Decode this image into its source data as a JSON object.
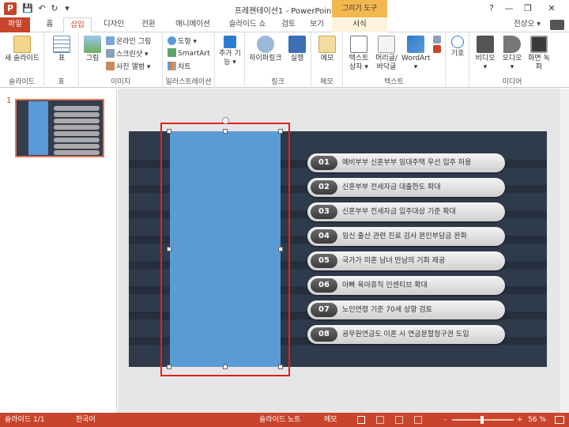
{
  "window": {
    "title": "프레젠테이션1 - PowerPoint",
    "app_icon_letter": "P",
    "context_tool": "그리기 도구",
    "help_glyph": "?",
    "minimize_glyph": "—",
    "restore_glyph": "❐",
    "close_glyph": "✕"
  },
  "quick_access": {
    "save_glyph": "💾",
    "undo_glyph": "↶",
    "redo_glyph": "↻",
    "customize_glyph": "▾"
  },
  "tabs": {
    "file": "파일",
    "home": "홈",
    "insert": "삽입",
    "design": "디자인",
    "transitions": "전환",
    "animations": "애니메이션",
    "slideshow": "슬라이드 쇼",
    "review": "검토",
    "view": "보기",
    "format": "서식"
  },
  "user": {
    "name": "전상오 ▾"
  },
  "ribbon": {
    "slides": {
      "label": "슬라이드",
      "new_slide": "새 슬라이드"
    },
    "tables": {
      "label": "표",
      "table": "표"
    },
    "images": {
      "label": "이미지",
      "picture": "그림",
      "online_picture": "온라인 그림",
      "screenshot": "스크린샷 ▾",
      "photo_album": "사진 앨범 ▾"
    },
    "illustrations": {
      "label": "일러스트레이션",
      "shapes": "도형 ▾",
      "smartart": "SmartArt",
      "chart": "차트"
    },
    "addins": {
      "label": "",
      "addins": "추가 기능 ▾"
    },
    "links": {
      "label": "링크",
      "hyperlink": "하이퍼링크",
      "action": "실행"
    },
    "comments": {
      "label": "메모",
      "comment": "메모"
    },
    "text": {
      "label": "텍스트",
      "textbox": "텍스트 상자 ▾",
      "header_footer": "머리글/ 바닥글",
      "wordart": "WordArt ▾"
    },
    "symbols": {
      "label": "",
      "symbol": "기호"
    },
    "media": {
      "label": "미디어",
      "video": "비디오 ▾",
      "audio": "오디오 ▾",
      "screen_recording": "화면 녹화"
    }
  },
  "thumbnail": {
    "number": "1"
  },
  "slide": {
    "items": [
      {
        "num": "01",
        "text": "예비부부 신혼부부 임대주택 우선 입주 허용"
      },
      {
        "num": "02",
        "text": "신혼부부 전세자금 대출한도 확대"
      },
      {
        "num": "03",
        "text": "신혼부부 전세자금 입주대상 기준 확대"
      },
      {
        "num": "04",
        "text": "임신 출산 관련 진료 검사 본인부담금 완화"
      },
      {
        "num": "05",
        "text": "국가가 미혼 남녀 만남의 기회 제공"
      },
      {
        "num": "06",
        "text": "아빠 육아휴직 인센티브 확대"
      },
      {
        "num": "07",
        "text": "노인연령 기준 70세 상향 검토"
      },
      {
        "num": "08",
        "text": "공무원연금도 이혼 시 연금분할청구권 도입"
      }
    ]
  },
  "status": {
    "slide_info": "슬라이드 1/1",
    "language": "한국어",
    "notes": "슬라이드 노트",
    "comments": "메모",
    "zoom_minus": "-",
    "zoom_plus": "+",
    "zoom": "56 %"
  },
  "colors": {
    "accent": "#c8442a",
    "slide_bg": "#2f3a4b",
    "blue_shape": "#5b9bd5",
    "selection": "#e0201f"
  }
}
